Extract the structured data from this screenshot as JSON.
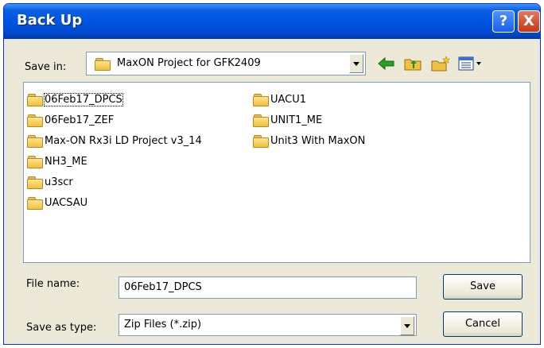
{
  "window": {
    "title": "Back Up",
    "help_glyph": "?",
    "close_glyph": "X"
  },
  "toolbar": {
    "save_in_label": "Save in:",
    "current_folder": "MaxON Project for GFK2409",
    "icons": [
      "back-arrow-icon",
      "up-folder-icon",
      "new-folder-icon",
      "view-menu-icon"
    ]
  },
  "list": {
    "items": [
      {
        "label": "06Feb17_DPCS",
        "selected": true
      },
      {
        "label": "06Feb17_ZEF"
      },
      {
        "label": "Max-ON Rx3i LD Project v3_14"
      },
      {
        "label": "NH3_ME"
      },
      {
        "label": "u3scr"
      },
      {
        "label": "UACSAU"
      },
      {
        "label": "UACU1"
      },
      {
        "label": "UNIT1_ME"
      },
      {
        "label": "Unit3 With MaxON"
      }
    ]
  },
  "form": {
    "file_name_label": "File name:",
    "file_name_value": "06Feb17_DPCS",
    "save_as_type_label": "Save as type:",
    "save_as_type_value": "Zip Files (*.zip)",
    "save_button": "Save",
    "cancel_button": "Cancel"
  },
  "colors": {
    "titlebar": "#0054e3",
    "dialog_bg": "#ece9d8",
    "folder": "#f0c040"
  }
}
